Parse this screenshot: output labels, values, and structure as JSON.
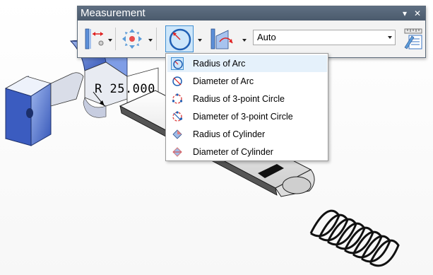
{
  "window": {
    "title": "Measurement",
    "dropdown_glyph": "▾",
    "close_glyph": "✕"
  },
  "toolbar": {
    "buttons": [
      {
        "name": "distance-tool",
        "icon": "point-to-plane-distance-icon"
      },
      {
        "name": "center-tool",
        "icon": "center-point-icon"
      },
      {
        "name": "arc-radius-tool",
        "icon": "arc-radius-icon",
        "active": true
      },
      {
        "name": "angle-tool",
        "icon": "angle-icon"
      },
      {
        "name": "settings-tool",
        "icon": "measurement-settings-icon"
      }
    ],
    "mode_value": "Auto"
  },
  "dimension_label": "R 25.000",
  "menu": {
    "items": [
      {
        "label": "Radius of Arc",
        "icon": "radius-of-arc-icon",
        "selected": true
      },
      {
        "label": "Diameter of Arc",
        "icon": "diameter-of-arc-icon"
      },
      {
        "label": "Radius of 3-point Circle",
        "icon": "radius-3point-circle-icon"
      },
      {
        "label": "Diameter of 3-point Circle",
        "icon": "diameter-3point-circle-icon"
      },
      {
        "label": "Radius of Cylinder",
        "icon": "radius-of-cylinder-icon"
      },
      {
        "label": "Diameter of Cylinder",
        "icon": "diameter-of-cylinder-icon"
      }
    ]
  },
  "colors": {
    "title_bar": "#4f5e70",
    "active_button_fill": "#cde6fa",
    "active_button_border": "#3f8fd2",
    "part_blue": "#5b7fd6"
  }
}
